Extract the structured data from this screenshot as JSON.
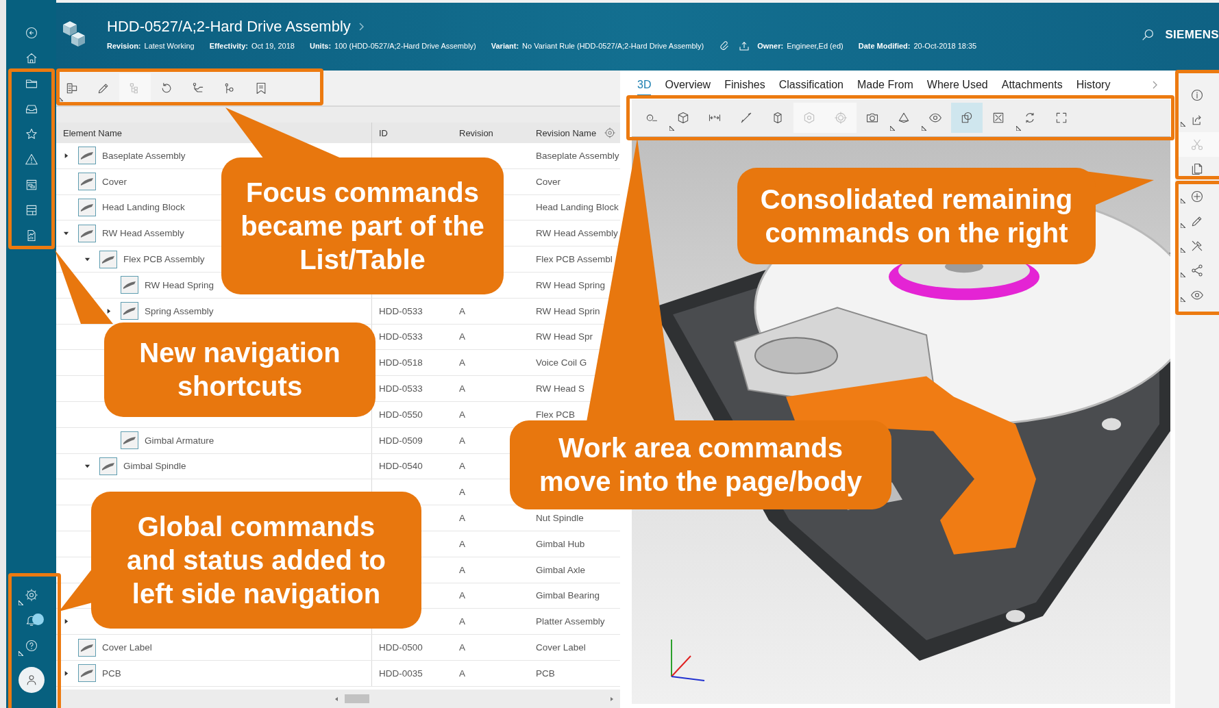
{
  "header": {
    "title": "HDD-0527/A;2-Hard Drive Assembly",
    "fields": [
      {
        "label": "Revision:",
        "value": "Latest Working"
      },
      {
        "label": "Effectivity:",
        "value": "Oct 19, 2018"
      },
      {
        "label": "Units:",
        "value": "100 (HDD-0527/A;2-Hard Drive Assembly)"
      },
      {
        "label": "Variant:",
        "value": "No Variant Rule (HDD-0527/A;2-Hard Drive Assembly)"
      }
    ],
    "owner": {
      "label": "Owner:",
      "value": "Engineer,Ed (ed)"
    },
    "modified": {
      "label": "Date Modified:",
      "value": "20-Oct-2018 18:35"
    },
    "brand": "SIEMENS"
  },
  "nav_bottom": [
    {
      "menu": true,
      "notification": false
    },
    {
      "menu": false,
      "notification": true
    },
    {
      "menu": true,
      "notification": false
    }
  ],
  "table_toolbar": [
    {
      "menu": true,
      "disabled": false
    },
    {
      "menu": false,
      "disabled": false
    },
    {
      "menu": false,
      "disabled": true
    },
    {
      "menu": false,
      "disabled": false
    },
    {
      "menu": false,
      "disabled": false
    },
    {
      "menu": false,
      "disabled": false
    },
    {
      "menu": false,
      "disabled": false
    }
  ],
  "table": {
    "columns": [
      "Element Name",
      "ID",
      "Revision",
      "Revision Name"
    ],
    "rows": [
      {
        "name": "Baseplate Assembly",
        "revision_name": "Baseplate Assembly",
        "expanded": false
      },
      {
        "name": "Cover",
        "revision_name": "Cover"
      },
      {
        "name": "Head Landing Block",
        "revision_name": "Head Landing Block"
      },
      {
        "name": "RW Head Assembly",
        "revision_name": "RW Head Assembly",
        "expanded": true,
        "children": [
          {
            "name": "Flex PCB Assembly",
            "revision_name": "Flex PCB Assembl",
            "expanded": true,
            "children": [
              {
                "name": "RW Head Spring",
                "revision_name": "RW Head Spring"
              },
              {
                "name": "Spring Assembly",
                "id": "HDD-0533",
                "revision": "A",
                "revision_name": "RW Head Sprin",
                "expanded": false
              },
              {
                "id": "HDD-0533",
                "revision": "A",
                "revision_name": "RW Head Spr"
              },
              {
                "id": "HDD-0518",
                "revision": "A",
                "revision_name": "Voice Coil G"
              },
              {
                "id": "HDD-0533",
                "revision": "A",
                "revision_name": "RW Head S"
              },
              {
                "id": "HDD-0550",
                "revision": "A",
                "revision_name": "Flex PCB"
              },
              {
                "name": "Gimbal Armature",
                "id": "HDD-0509",
                "revision": "A"
              }
            ]
          },
          {
            "name": "Gimbal Spindle",
            "id": "HDD-0540",
            "revision": "A",
            "expanded": true,
            "children": [
              {
                "revision": "A"
              },
              {
                "revision": "A",
                "revision_name": "Nut Spindle"
              },
              {
                "revision": "A",
                "revision_name": "Gimbal Hub"
              },
              {
                "revision": "A",
                "revision_name": "Gimbal Axle"
              },
              {
                "revision": "A",
                "revision_name": "Gimbal Bearing"
              }
            ]
          }
        ]
      },
      {
        "revision": "A",
        "revision_name": "Platter Assembly",
        "expanded": false
      },
      {
        "name": "Cover Label",
        "id": "HDD-0500",
        "revision": "A",
        "revision_name": "Cover Label"
      },
      {
        "name": "PCB",
        "id": "HDD-0035",
        "revision": "A",
        "revision_name": "PCB",
        "expanded": false
      }
    ]
  },
  "tabs": [
    {
      "label": "3D",
      "selected": true
    },
    {
      "label": "Overview",
      "selected": false
    },
    {
      "label": "Finishes",
      "selected": false
    },
    {
      "label": "Classification",
      "selected": false
    },
    {
      "label": "Made From",
      "selected": false
    },
    {
      "label": "Where Used",
      "selected": false
    },
    {
      "label": "Attachments",
      "selected": false
    },
    {
      "label": "History",
      "selected": false
    }
  ],
  "viewer_toolbar": [
    {
      "menu": false,
      "disabled": false,
      "selected": false
    },
    {
      "menu": true,
      "disabled": false,
      "selected": false
    },
    {
      "menu": false,
      "disabled": false,
      "selected": false
    },
    {
      "menu": false,
      "disabled": false,
      "selected": false
    },
    {
      "menu": false,
      "disabled": false,
      "selected": false
    },
    {
      "menu": false,
      "disabled": true,
      "selected": false
    },
    {
      "menu": false,
      "disabled": true,
      "selected": false
    },
    {
      "menu": false,
      "disabled": false,
      "selected": false
    },
    {
      "menu": true,
      "disabled": false,
      "selected": false
    },
    {
      "menu": true,
      "disabled": false,
      "selected": false
    },
    {
      "menu": false,
      "disabled": false,
      "selected": true
    },
    {
      "menu": false,
      "disabled": false,
      "selected": false
    },
    {
      "menu": true,
      "disabled": false,
      "selected": false
    },
    {
      "menu": false,
      "disabled": false,
      "selected": false
    }
  ],
  "right_rail": [
    [
      {
        "menu": false,
        "disabled": false
      },
      {
        "menu": true,
        "disabled": false
      },
      {
        "menu": false,
        "disabled": true
      },
      {
        "menu": false,
        "disabled": false
      }
    ],
    [
      {
        "menu": true,
        "disabled": false
      },
      {
        "menu": true,
        "disabled": false
      },
      {
        "menu": true,
        "disabled": false
      },
      {
        "menu": true,
        "disabled": false
      },
      {
        "menu": true,
        "disabled": false
      }
    ]
  ],
  "callouts": [
    {
      "text": "Focus commands became part of the List/Table"
    },
    {
      "text": "Consolidated remaining commands on the right"
    },
    {
      "text": "New navigation shortcuts"
    },
    {
      "text": "Work area commands move into the page/body"
    },
    {
      "text": "Global commands and status added to left side navigation"
    }
  ]
}
